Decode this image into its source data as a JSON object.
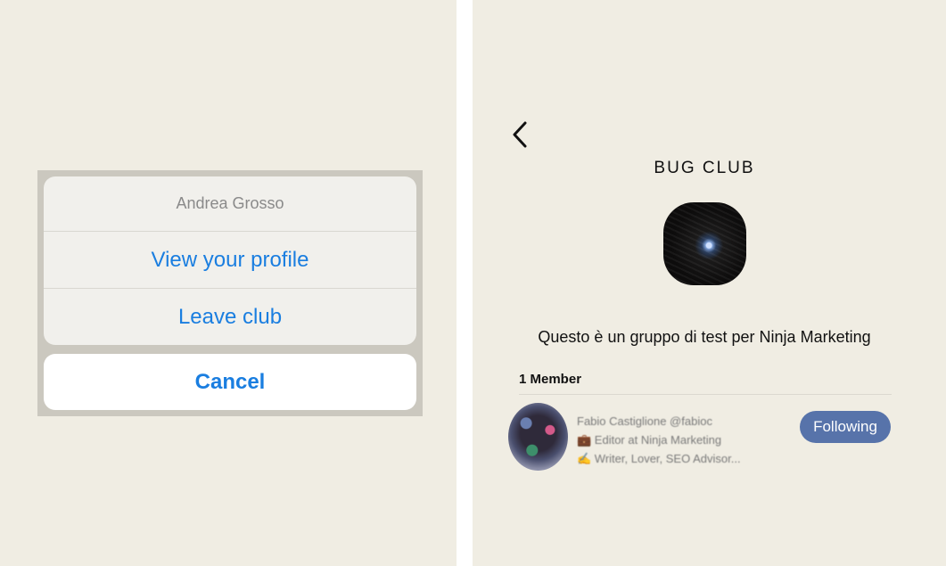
{
  "action_sheet": {
    "title": "Andrea Grosso",
    "actions": [
      "View your profile",
      "Leave club"
    ],
    "cancel_label": "Cancel"
  },
  "club": {
    "name": "BUG CLUB",
    "description": "Questo è un gruppo di test per Ninja Marketing",
    "members_label": "1 Member",
    "member": {
      "lines": [
        "Fabio Castiglione @fabioc",
        "💼 Editor at Ninja Marketing",
        "✍️ Writer, Lover, SEO Advisor..."
      ],
      "follow_label": "Following"
    }
  },
  "colors": {
    "background": "#f0ede3",
    "link_blue": "#1a7ee0",
    "follow_button": "#5773aa"
  },
  "icons": {
    "back": "chevron-left-icon"
  }
}
